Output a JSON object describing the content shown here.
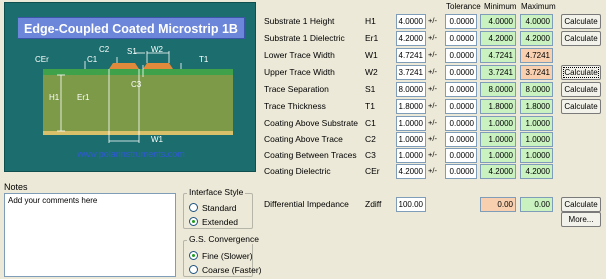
{
  "diagram": {
    "title": "Edge-Coupled Coated Microstrip 1B",
    "url": "www.polarinstruments.com",
    "labels": {
      "cer": "CEr",
      "c1": "C1",
      "c2": "C2",
      "s1": "S1",
      "w2": "W2",
      "t1": "T1",
      "c3": "C3",
      "h1": "H1",
      "er1": "Er1",
      "w1": "W1"
    }
  },
  "headers": {
    "tolerance": "Tolerance",
    "minimum": "Minimum",
    "maximum": "Maximum"
  },
  "params": [
    {
      "label": "Substrate 1 Height",
      "symbol": "H1",
      "value": "4.0000",
      "pm": "+/-",
      "tol": "0.0000",
      "min": "4.0000",
      "max": "4.0000",
      "button": "Calculate"
    },
    {
      "label": "Substrate 1 Dielectric",
      "symbol": "Er1",
      "value": "4.2000",
      "pm": "+/-",
      "tol": "0.0000",
      "min": "4.2000",
      "max": "4.2000",
      "button": "Calculate"
    },
    {
      "label": "Lower Trace Width",
      "symbol": "W1",
      "value": "4.7241",
      "pm": "+/-",
      "tol": "0.0000",
      "min": "4.7241",
      "max": "4.7241"
    },
    {
      "label": "Upper Trace Width",
      "symbol": "W2",
      "value": "3.7241",
      "pm": "+/-",
      "tol": "0.0000",
      "min": "3.7241",
      "max": "3.7241",
      "button": "Calculate"
    },
    {
      "label": "Trace Separation",
      "symbol": "S1",
      "value": "8.0000",
      "pm": "+/-",
      "tol": "0.0000",
      "min": "8.0000",
      "max": "8.0000",
      "button": "Calculate"
    },
    {
      "label": "Trace Thickness",
      "symbol": "T1",
      "value": "1.8000",
      "pm": "+/-",
      "tol": "0.0000",
      "min": "1.8000",
      "max": "1.8000",
      "button": "Calculate"
    },
    {
      "label": "Coating Above Substrate",
      "symbol": "C1",
      "value": "1.0000",
      "pm": "+/-",
      "tol": "0.0000",
      "min": "1.0000",
      "max": "1.0000"
    },
    {
      "label": "Coating Above Trace",
      "symbol": "C2",
      "value": "1.0000",
      "pm": "+/-",
      "tol": "0.0000",
      "min": "1.0000",
      "max": "1.0000"
    },
    {
      "label": "Coating Between Traces",
      "symbol": "C3",
      "value": "1.0000",
      "pm": "+/-",
      "tol": "0.0000",
      "min": "1.0000",
      "max": "1.0000"
    },
    {
      "label": "Coating Dielectric",
      "symbol": "CEr",
      "value": "4.2000",
      "pm": "+/-",
      "tol": "0.0000",
      "min": "4.2000",
      "max": "4.2000"
    }
  ],
  "impedance": {
    "label": "Differential Impedance",
    "symbol": "Zdiff",
    "value": "100.00",
    "min": "0.00",
    "max": "0.00",
    "calculate": "Calculate",
    "more": "More..."
  },
  "notes": {
    "label": "Notes",
    "text": "Add your comments here"
  },
  "interface_style": {
    "title": "Interface Style",
    "options": [
      "Standard",
      "Extended"
    ],
    "selected": "Extended"
  },
  "convergence": {
    "title": "G.S. Convergence",
    "options": [
      "Fine (Slower)",
      "Coarse (Faster)"
    ],
    "selected": "Fine (Slower)"
  },
  "colors": {
    "min_bg": "#c9f2c0",
    "impedance_bg": "#f8d0b0",
    "diagram_bg": "#1c6e6e",
    "title_bg": "#6c86d9"
  }
}
